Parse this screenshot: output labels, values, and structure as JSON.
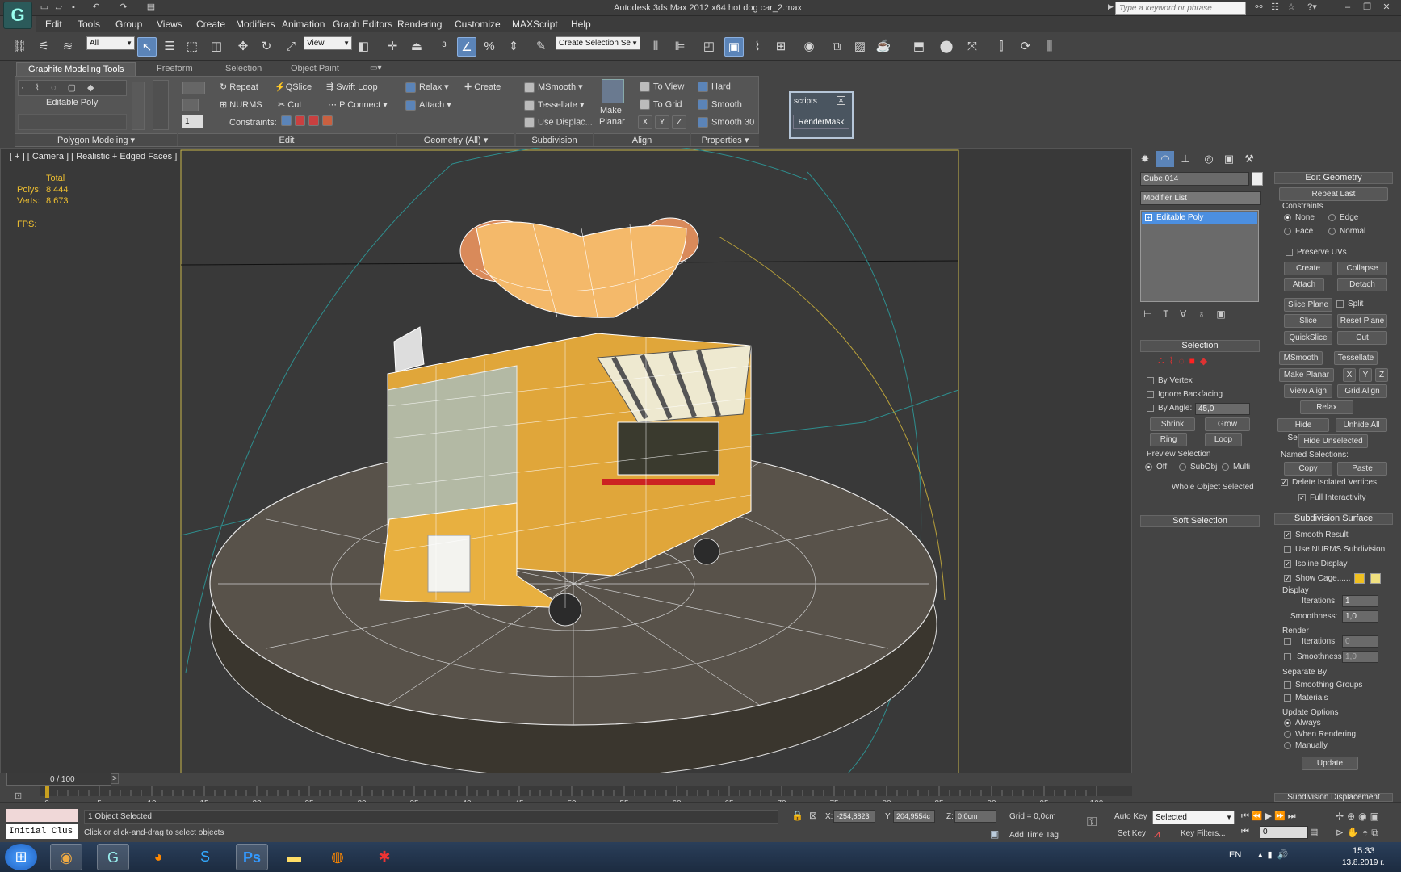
{
  "window": {
    "title": "Autodesk 3ds Max  2012 x64      hot dog car_2.max",
    "search_placeholder": "Type a keyword or phrase"
  },
  "menu": [
    "Edit",
    "Tools",
    "Group",
    "Views",
    "Create",
    "Modifiers",
    "Animation",
    "Graph Editors",
    "Rendering",
    "Customize",
    "MAXScript",
    "Help"
  ],
  "toolbar": {
    "selection_filter": "All",
    "ref_coord": "View",
    "named_selection": "Create Selection Se"
  },
  "ribbon": {
    "tabs": [
      "Graphite Modeling Tools",
      "Freeform",
      "Selection",
      "Object Paint"
    ],
    "polygon_modeling": {
      "mode": "Editable Poly",
      "footer": "Polygon Modeling"
    },
    "spinner_value": "1",
    "edit": {
      "items": [
        "Repeat",
        "QSlice",
        "Swift Loop",
        "NURMS",
        "Cut",
        "P Connect"
      ],
      "constraints_label": "Constraints:",
      "footer": "Edit"
    },
    "geometry": {
      "items": [
        "Relax",
        "Create",
        "Attach"
      ],
      "footer": "Geometry (All)"
    },
    "subdivision": {
      "items": [
        "MSmooth",
        "Tessellate",
        "Use Displac..."
      ],
      "footer": "Subdivision"
    },
    "align": {
      "make_planar_line1": "Make",
      "make_planar_line2": "Planar",
      "items": [
        "To View",
        "To Grid"
      ],
      "axes": [
        "X",
        "Y",
        "Z"
      ],
      "footer": "Align"
    },
    "properties": {
      "items": [
        "Hard",
        "Smooth",
        "Smooth 30"
      ],
      "footer": "Properties"
    }
  },
  "scripts": {
    "title": "scripts",
    "button": "RenderMask"
  },
  "viewport": {
    "label": "[ + ] [ Camera ] [ Realistic + Edged Faces ]",
    "stats": {
      "total_label": "Total",
      "polys_label": "Polys:",
      "polys": "8 444",
      "verts_label": "Verts:",
      "verts": "8 673",
      "fps_label": "FPS:"
    }
  },
  "command_panel": {
    "object_name": "Cube.014",
    "modifier_list": "Modifier List",
    "stack_item": "Editable Poly",
    "selection": {
      "header": "Selection",
      "by_vertex": "By Vertex",
      "ignore_backfacing": "Ignore Backfacing",
      "by_angle": "By Angle:",
      "angle_value": "45,0",
      "shrink": "Shrink",
      "grow": "Grow",
      "ring": "Ring",
      "loop": "Loop",
      "preview_label": "Preview Selection",
      "preview_options": [
        "Off",
        "SubObj",
        "Multi"
      ],
      "status": "Whole Object Selected"
    },
    "soft_selection": "Soft Selection",
    "edit_geometry": {
      "header": "Edit Geometry",
      "repeat_last": "Repeat Last",
      "constraints_label": "Constraints",
      "constraints": [
        "None",
        "Edge",
        "Face",
        "Normal"
      ],
      "preserve_uvs": "Preserve UVs",
      "create": "Create",
      "collapse": "Collapse",
      "attach": "Attach",
      "detach": "Detach",
      "slice_plane": "Slice Plane",
      "split": "Split",
      "slice": "Slice",
      "reset_plane": "Reset Plane",
      "quickslice": "QuickSlice",
      "cut": "Cut",
      "msmooth": "MSmooth",
      "tessellate": "Tessellate",
      "make_planar": "Make Planar",
      "x": "X",
      "y": "Y",
      "z": "Z",
      "view_align": "View Align",
      "grid_align": "Grid Align",
      "relax": "Relax",
      "hide_selected": "Hide Selected",
      "unhide_all": "Unhide All",
      "hide_unselected": "Hide Unselected",
      "named_selections": "Named Selections:",
      "copy": "Copy",
      "paste": "Paste",
      "delete_isolated": "Delete Isolated Vertices",
      "full_interactivity": "Full Interactivity"
    },
    "subdivision_surface": {
      "header": "Subdivision Surface",
      "smooth_result": "Smooth Result",
      "use_nurms": "Use NURMS Subdivision",
      "isoline_display": "Isoline Display",
      "show_cage": "Show Cage......",
      "display_label": "Display",
      "iterations_label": "Iterations:",
      "display_iterations": "1",
      "smoothness_label": "Smoothness:",
      "display_smoothness": "1,0",
      "render_label": "Render",
      "render_iterations": "0",
      "render_smoothness": "1,0",
      "separate_by": "Separate By",
      "smoothing_groups": "Smoothing Groups",
      "materials": "Materials",
      "update_options": "Update Options",
      "update_choices": [
        "Always",
        "When Rendering",
        "Manually"
      ],
      "update": "Update"
    },
    "subdivision_displacement": "Subdivision Displacement",
    "cage_colors": [
      "#f0c020",
      "#f0e080"
    ]
  },
  "timeline": {
    "frame_range": "0 / 100",
    "ticks": [
      "0",
      "5",
      "10",
      "15",
      "20",
      "25",
      "30",
      "35",
      "40",
      "45",
      "50",
      "55",
      "60",
      "65",
      "70",
      "75",
      "80",
      "85",
      "90",
      "95",
      "100"
    ]
  },
  "status": {
    "objects_selected": "1 Object Selected",
    "prompt": "Click or click-and-drag to select objects",
    "maxscript_text": "Initial Clus",
    "x_label": "X:",
    "x": "-254,8823",
    "y_label": "Y:",
    "y": "204,9554c",
    "z_label": "Z:",
    "z": "0,0cm",
    "grid": "Grid = 0,0cm",
    "add_time_tag": "Add Time Tag",
    "auto_key": "Auto Key",
    "set_key": "Set Key",
    "key_mode": "Selected",
    "key_filters": "Key Filters...",
    "frame": "0"
  },
  "taskbar": {
    "language": "EN",
    "time": "15:33",
    "date": "13.8.2019 г."
  }
}
